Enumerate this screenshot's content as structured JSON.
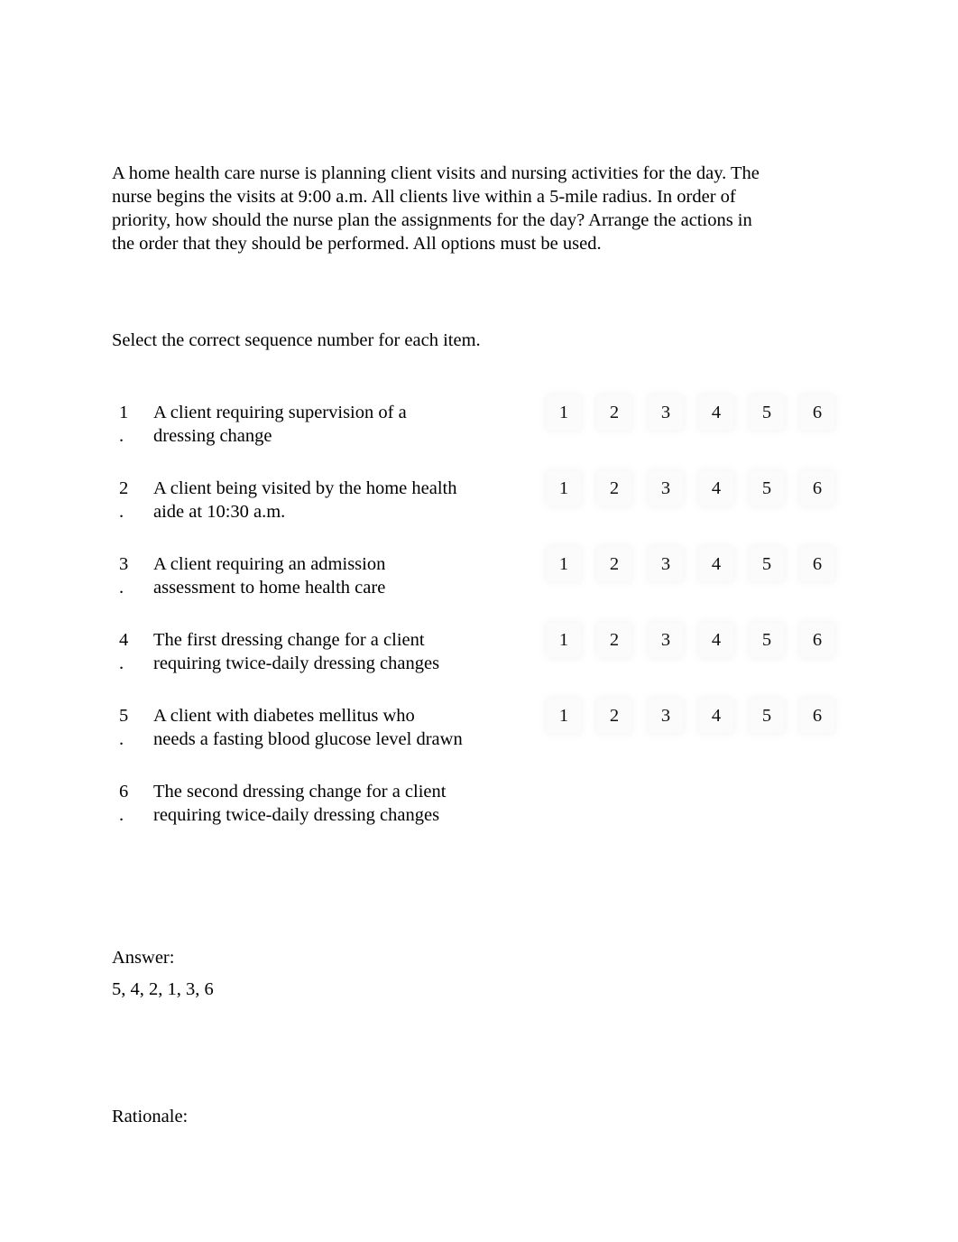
{
  "document": {
    "question_text": "A home health care nurse is planning client visits and nursing activities for the day. The nurse begins the visits at 9:00 a.m. All clients live within a 5-mile radius. In order of priority, how should the nurse plan the assignments for the day? Arrange the actions in the order that they should be performed. All options must be used.",
    "instruction": "Select the correct sequence number for each item.",
    "answer_label": "Answer:",
    "answer_value": "5, 4, 2, 1, 3, 6",
    "rationale_label": "Rationale:"
  },
  "items": [
    {
      "number": "1",
      "dot": ".",
      "lines": [
        "A client requiring supervision of a",
        "dressing change"
      ],
      "options": [
        "1",
        "2",
        "3",
        "4",
        "5",
        "6"
      ],
      "has_options": true
    },
    {
      "number": "2",
      "dot": ".",
      "lines": [
        "A client being visited by the home health",
        "aide at 10:30 a.m."
      ],
      "options": [
        "1",
        "2",
        "3",
        "4",
        "5",
        "6"
      ],
      "has_options": true
    },
    {
      "number": "3",
      "dot": ".",
      "lines": [
        "A client requiring an admission",
        "assessment to home health care"
      ],
      "options": [
        "1",
        "2",
        "3",
        "4",
        "5",
        "6"
      ],
      "has_options": true
    },
    {
      "number": "4",
      "dot": ".",
      "lines": [
        "The first dressing change for a client",
        "requiring twice-daily dressing changes"
      ],
      "options": [
        "1",
        "2",
        "3",
        "4",
        "5",
        "6"
      ],
      "has_options": true
    },
    {
      "number": "5",
      "dot": ".",
      "lines": [
        "A client with diabetes mellitus who",
        "needs a fasting blood glucose level drawn"
      ],
      "options": [
        "1",
        "2",
        "3",
        "4",
        "5",
        "6"
      ],
      "has_options": true
    },
    {
      "number": "6",
      "dot": ".",
      "lines": [
        "The second dressing change for a client",
        "requiring twice-daily dressing changes"
      ],
      "options": [],
      "has_options": false
    }
  ]
}
